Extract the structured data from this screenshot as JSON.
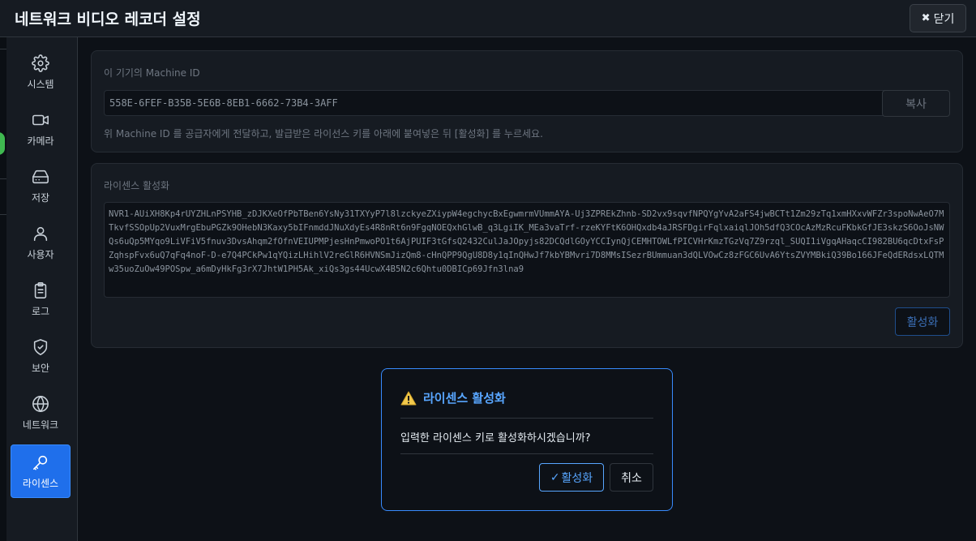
{
  "window": {
    "title": "네트워크 비디오 레코더 설정",
    "close_label": "닫기"
  },
  "sidebar": {
    "items": [
      {
        "label": "시스템",
        "icon": "gear-icon"
      },
      {
        "label": "카메라",
        "icon": "video-camera-icon"
      },
      {
        "label": "저장",
        "icon": "hard-drive-icon"
      },
      {
        "label": "사용자",
        "icon": "user-icon"
      },
      {
        "label": "로그",
        "icon": "clipboard-icon"
      },
      {
        "label": "보안",
        "icon": "shield-check-icon"
      },
      {
        "label": "네트워크",
        "icon": "globe-icon"
      },
      {
        "label": "라이센스",
        "icon": "key-icon"
      }
    ],
    "active": "라이센스"
  },
  "machine_id": {
    "label": "이 기기의 Machine ID",
    "value": "558E-6FEF-B35B-5E6B-8EB1-6662-73B4-3AFF",
    "copy_label": "복사",
    "hint": "위 Machine ID 를 공급자에게 전달하고, 발급받은 라이선스 키를 아래에 붙여넣은 뒤 [활성화] 를 누르세요."
  },
  "license": {
    "label": "라이센스 활성화",
    "key": "NVR1-AUiXH8Kp4rUYZHLnPSYHB_zDJKXeOfPbTBen6YsNy31TXYyP7l8lzckyeZXiypW4egchycBxEgwmrmVUmmAYA-Uj3ZPREkZhnb-SD2vx9sqvfNPQYgYvA2aFS4jwBCTt1Zm29zTq1xmHXxvWFZr3spoNwAeO7MTkvfSSOpUp2VuxMrgEbuPGZk9OHebN3Kaxy5bIFnmddJNuXdyEs4R8nRt6n9FgqNOEQxhGlwB_q3LgiIK_MEa3vaTrf-rzeKYFtK6OHQxdb4aJRSFDgirFqlxaiqlJOh5dfQ3COcAzMzRcuFKbkGfJE3skzS6OoJsNWQs6uQp5MYqo9LiVFiV5fnuv3DvsAhqm2fOfnVEIUPMPjesHnPmwoPO1t6AjPUIF3tGfsQ2432CulJaJOpyjs82DCQdlGOyYCCIynQjCEMHTOWLfPICVHrKmzTGzVq7Z9rzql_SUQI1iVgqAHaqcCI982BU6qcDtxFsPZqhspFvx6uQ7qFq4noF-D-e7Q4PCkPw1qYQizLHihlV2reGlR6HVNSmJizQm8-cHnQPP9QgU8D8y1qInQHwJf7kbYBMvri7D8MMsISezrBUmmuan3dQLVOwCz8zFGC6UvA6YtsZVYMBkiQ39Bo166JFeQdERdsxLQTMw35uoZuOw49POSpw_a6mDyHkFg3rX7JhtW1PH5Ak_xiQs3gs44UcwX4B5N2c6Qhtu0DBICp69Jfn3lna9",
    "activate_label": "활성화"
  },
  "dialog": {
    "title": "라이센스 활성화",
    "icon": "warning-icon",
    "message": "입력한 라이센스 키로 활성화하시겠습니까?",
    "confirm_label": "활성화",
    "cancel_label": "취소"
  }
}
